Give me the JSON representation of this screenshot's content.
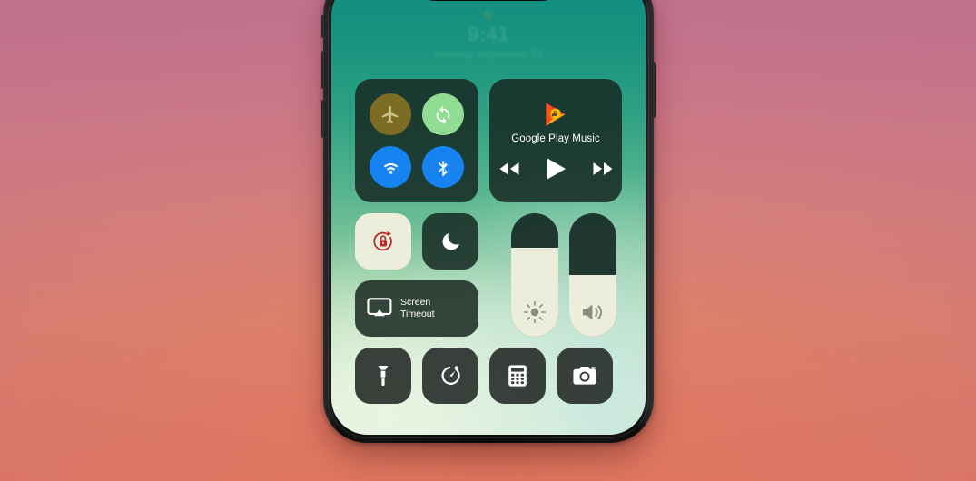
{
  "background": {
    "gradient_top": "#c0718e",
    "gradient_bottom": "#e0775f"
  },
  "device": {
    "frame_color": "#0a0a0b",
    "wallpaper_top": "#0e8c7e",
    "wallpaper_bottom": "#dfeed5"
  },
  "lockscreen": {
    "lock_icon": "lock-glyph",
    "time": "9:41",
    "date": "Monday, September 25"
  },
  "control_center": {
    "toggles": [
      {
        "name": "airplane-mode",
        "label": "Airplane Mode",
        "state": "off",
        "color": "#7d6d24"
      },
      {
        "name": "auto-rotate",
        "label": "Auto Rotate",
        "state": "on",
        "color": "#8fdc92"
      },
      {
        "name": "wifi",
        "label": "Wi-Fi",
        "state": "on",
        "color": "#1683f0"
      },
      {
        "name": "bluetooth",
        "label": "Bluetooth",
        "state": "on",
        "color": "#1683f0"
      }
    ],
    "media": {
      "app_name": "Google Play Music",
      "logo_colors": [
        "#ea4335",
        "#fbbc04",
        "#f57c00"
      ],
      "controls": [
        {
          "name": "previous",
          "label": "Rewind"
        },
        {
          "name": "play",
          "label": "Play"
        },
        {
          "name": "next",
          "label": "Fast Forward"
        }
      ]
    },
    "rotation_lock": {
      "label": "Rotation Lock",
      "state": "on",
      "bg": "#eceedb",
      "icon_color": "#b52b2b"
    },
    "night_mode": {
      "label": "Do Not Disturb",
      "state": "off"
    },
    "screen_timeout": {
      "label_line1": "Screen",
      "label_line2": "Timeout"
    },
    "brightness": {
      "label": "Brightness",
      "value": 72,
      "unit": "%"
    },
    "volume": {
      "label": "Volume",
      "value": 50,
      "unit": "%"
    },
    "shortcuts": [
      {
        "name": "flashlight",
        "label": "Flashlight"
      },
      {
        "name": "timer",
        "label": "Timer"
      },
      {
        "name": "calculator",
        "label": "Calculator"
      },
      {
        "name": "camera",
        "label": "Camera"
      }
    ]
  }
}
